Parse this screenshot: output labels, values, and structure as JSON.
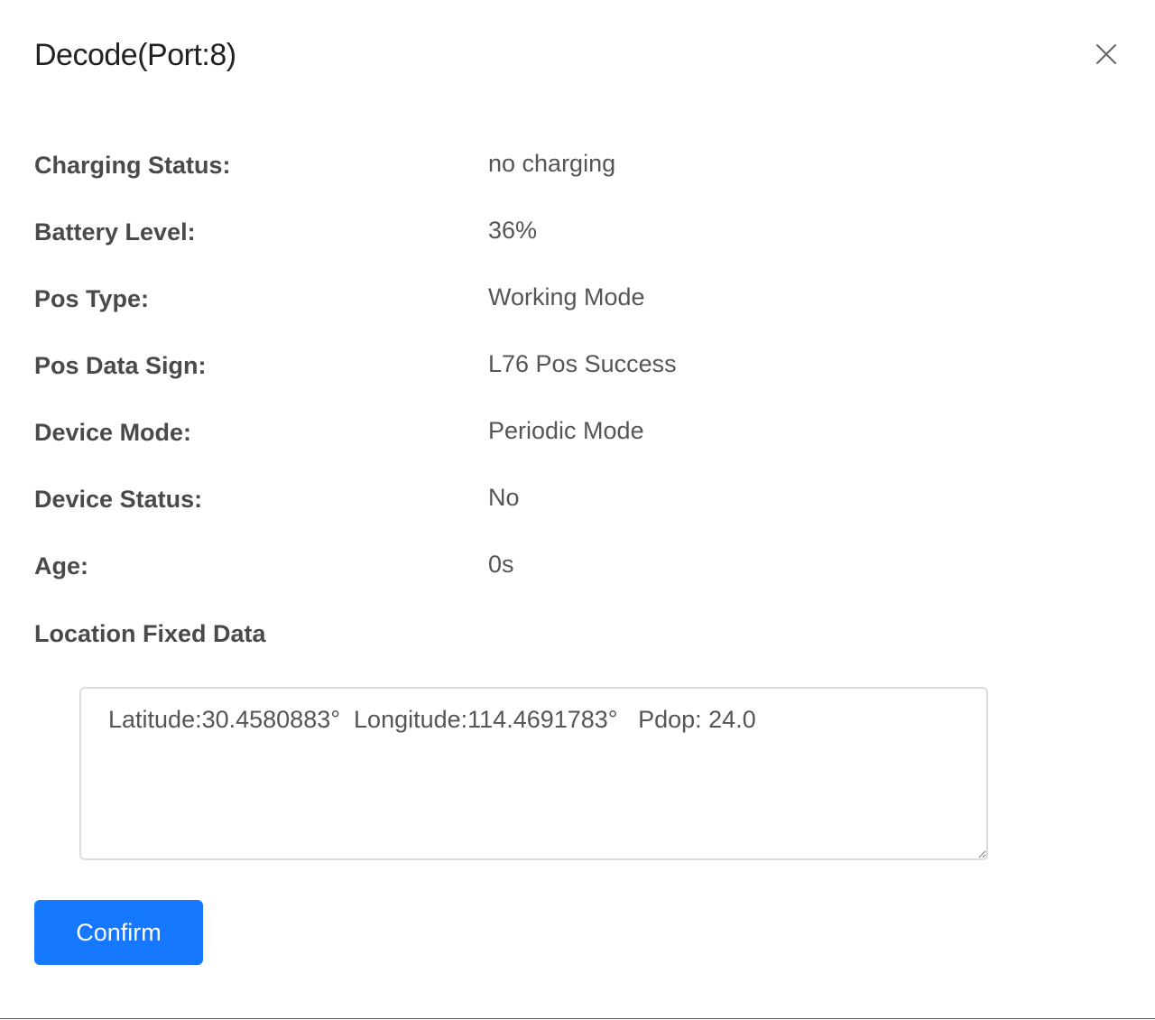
{
  "dialog": {
    "title": "Decode(Port:8)",
    "close_icon": "close-icon"
  },
  "fields": [
    {
      "label": "Charging Status:",
      "value": "no charging"
    },
    {
      "label": "Battery Level:",
      "value": "36%"
    },
    {
      "label": "Pos Type:",
      "value": "Working Mode"
    },
    {
      "label": "Pos Data Sign:",
      "value": "L76 Pos Success"
    },
    {
      "label": "Device Mode:",
      "value": "Periodic Mode"
    },
    {
      "label": "Device Status:",
      "value": "No"
    },
    {
      "label": "Age:",
      "value": "0s"
    }
  ],
  "location": {
    "section_title": "Location Fixed Data",
    "text": "Latitude:30.4580883°  Longitude:114.4691783°   Pdop: 24.0"
  },
  "footer": {
    "confirm_label": "Confirm"
  },
  "colors": {
    "primary": "#1677ff",
    "label": "#4a4a4a",
    "value": "#555555",
    "border": "#dcdcdc"
  }
}
